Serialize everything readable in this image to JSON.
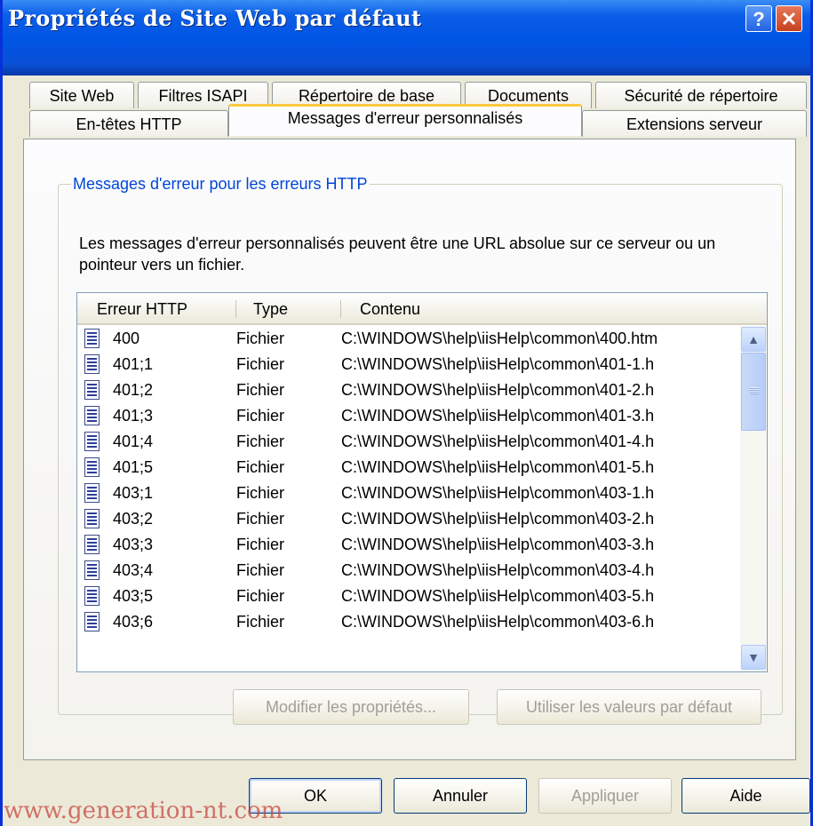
{
  "window": {
    "title": "Propriétés de Site Web par défaut",
    "help_button": "?",
    "close_button": "✕"
  },
  "tabs": {
    "row1": [
      "Site Web",
      "Filtres ISAPI",
      "Répertoire de base",
      "Documents",
      "Sécurité de répertoire"
    ],
    "row2": [
      "En-têtes HTTP",
      "Messages d'erreur personnalisés",
      "Extensions serveur"
    ],
    "active": "Messages d'erreur personnalisés"
  },
  "group": {
    "legend": "Messages d'erreur pour les erreurs HTTP",
    "description": "Les messages d'erreur personnalisés peuvent être une URL absolue sur ce serveur ou un pointeur vers un fichier."
  },
  "list": {
    "columns": [
      "Erreur HTTP",
      "Type",
      "Contenu"
    ],
    "rows": [
      {
        "code": "400",
        "type": "Fichier",
        "path": "C:\\WINDOWS\\help\\iisHelp\\common\\400.htm"
      },
      {
        "code": "401;1",
        "type": "Fichier",
        "path": "C:\\WINDOWS\\help\\iisHelp\\common\\401-1.h"
      },
      {
        "code": "401;2",
        "type": "Fichier",
        "path": "C:\\WINDOWS\\help\\iisHelp\\common\\401-2.h"
      },
      {
        "code": "401;3",
        "type": "Fichier",
        "path": "C:\\WINDOWS\\help\\iisHelp\\common\\401-3.h"
      },
      {
        "code": "401;4",
        "type": "Fichier",
        "path": "C:\\WINDOWS\\help\\iisHelp\\common\\401-4.h"
      },
      {
        "code": "401;5",
        "type": "Fichier",
        "path": "C:\\WINDOWS\\help\\iisHelp\\common\\401-5.h"
      },
      {
        "code": "403;1",
        "type": "Fichier",
        "path": "C:\\WINDOWS\\help\\iisHelp\\common\\403-1.h"
      },
      {
        "code": "403;2",
        "type": "Fichier",
        "path": "C:\\WINDOWS\\help\\iisHelp\\common\\403-2.h"
      },
      {
        "code": "403;3",
        "type": "Fichier",
        "path": "C:\\WINDOWS\\help\\iisHelp\\common\\403-3.h"
      },
      {
        "code": "403;4",
        "type": "Fichier",
        "path": "C:\\WINDOWS\\help\\iisHelp\\common\\403-4.h"
      },
      {
        "code": "403;5",
        "type": "Fichier",
        "path": "C:\\WINDOWS\\help\\iisHelp\\common\\403-5.h"
      },
      {
        "code": "403;6",
        "type": "Fichier",
        "path": "C:\\WINDOWS\\help\\iisHelp\\common\\403-6.h"
      }
    ],
    "scroll_up": "▲",
    "scroll_down": "▼"
  },
  "group_buttons": {
    "edit": "Modifier les propriétés...",
    "default": "Utiliser les valeurs par défaut"
  },
  "dialog_buttons": {
    "ok": "OK",
    "cancel": "Annuler",
    "apply": "Appliquer",
    "help": "Aide"
  },
  "watermark": "www.generation-nt.com",
  "colors": {
    "titlebar": "#0054e3",
    "legend": "#0046d5",
    "active_tab_accent": "#ffc83c",
    "watermark": "#c6413a"
  }
}
